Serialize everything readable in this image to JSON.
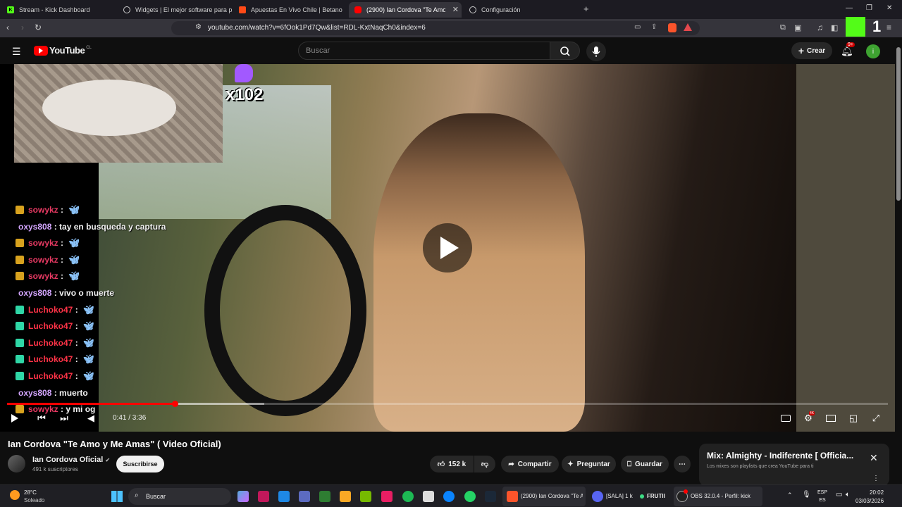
{
  "browser": {
    "tabs": [
      {
        "label": "Stream - Kick Dashboard",
        "icon": "kick-icon"
      },
      {
        "label": "Widgets | El mejor software para pod",
        "icon": "widgets-icon"
      },
      {
        "label": "Apuestas En Vivo Chile | Betano",
        "icon": "betano-icon"
      },
      {
        "label": "(2900) Ian Cordova \"Te Amo y M",
        "icon": "youtube-icon"
      },
      {
        "label": "Configuración",
        "icon": "gear-icon"
      }
    ],
    "url": "youtube.com/watch?v=6fOok1Pd7Qw&list=RDL-KxtNaqCh0&index=6"
  },
  "youtube": {
    "logo_text": "YouTube",
    "country_code": "CL",
    "search_placeholder": "Buscar",
    "create_label": "Crear",
    "notif_count": "9+",
    "avatar_letter": "i"
  },
  "overlay": {
    "gift_count": "x102",
    "chat": [
      {
        "user": "sowykz",
        "msg": "",
        "style": "u1",
        "badge": "#d8a21e",
        "emote": true
      },
      {
        "user": "oxys808",
        "msg": "tay en busqueda y captura",
        "style": "u2",
        "badge": "",
        "emote": false
      },
      {
        "user": "sowykz",
        "msg": "",
        "style": "u1",
        "badge": "#d8a21e",
        "emote": true
      },
      {
        "user": "sowykz",
        "msg": "",
        "style": "u1",
        "badge": "#d8a21e",
        "emote": true
      },
      {
        "user": "sowykz",
        "msg": "",
        "style": "u1",
        "badge": "#d8a21e",
        "emote": true
      },
      {
        "user": "oxys808",
        "msg": "vivo o muerte",
        "style": "u2",
        "badge": "",
        "emote": false
      },
      {
        "user": "Luchoko47",
        "msg": "",
        "style": "u3",
        "badge": "#2fd6a6",
        "emote": true
      },
      {
        "user": "Luchoko47",
        "msg": "",
        "style": "u3",
        "badge": "#2fd6a6",
        "emote": true
      },
      {
        "user": "Luchoko47",
        "msg": "",
        "style": "u3",
        "badge": "#2fd6a6",
        "emote": true
      },
      {
        "user": "Luchoko47",
        "msg": "",
        "style": "u3",
        "badge": "#2fd6a6",
        "emote": true
      },
      {
        "user": "Luchoko47",
        "msg": "",
        "style": "u3",
        "badge": "#2fd6a6",
        "emote": true
      },
      {
        "user": "oxys808",
        "msg": "muerto",
        "style": "u2",
        "badge": "",
        "emote": false
      },
      {
        "user": "sowykz",
        "msg": "y mi og",
        "style": "u1",
        "badge": "#d8a21e",
        "emote": false
      }
    ]
  },
  "player": {
    "time": "0:41 / 3:36",
    "progress_fraction": 0.19
  },
  "video": {
    "title": "Ian Cordova \"Te Amo y Me Amas\" ( Video Oficial)",
    "channel": "Ian Cordova Oficial",
    "subscribers": "491 k suscriptores",
    "subscribe_label": "Suscribirse",
    "likes": "152 k",
    "share_label": "Compartir",
    "ask_label": "Preguntar",
    "save_label": "Guardar"
  },
  "mix": {
    "title": "Mix: Almighty - Indiferente [ Officia...",
    "subtitle": "Los mixes son playlists que crea YouTube para ti"
  },
  "taskbar": {
    "temp": "28°C",
    "weather": "Soleado",
    "search_label": "Buscar",
    "brave_label": "(2900) Ian Cordova \"Te A",
    "discord_label": "[SALA] 1 k",
    "frutii_label": "FRUTII",
    "obs_label": "OBS 32.0.4 - Perfil: kick",
    "lang": "ESP",
    "lang_sub": "ES",
    "time": "20:02",
    "date": "03/03/2026"
  },
  "colors": {
    "accent_red": "#ff0000",
    "kick_green": "#53fc18"
  }
}
